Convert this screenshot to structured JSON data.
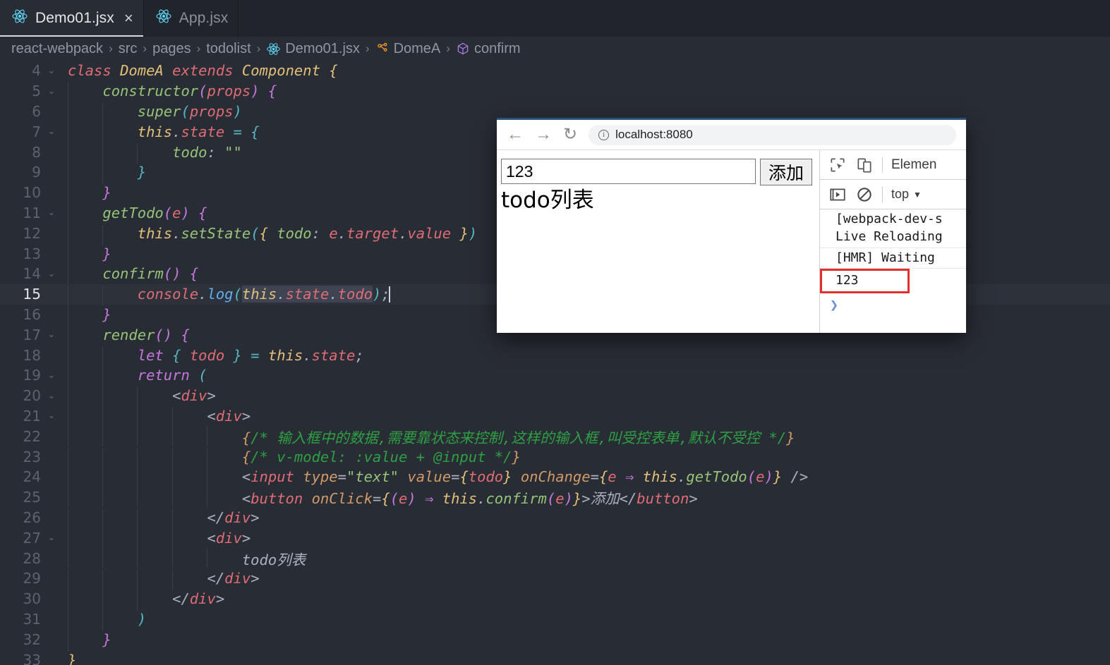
{
  "editor": {
    "tabs": [
      {
        "label": "Demo01.jsx",
        "icon": "react-icon",
        "active": true,
        "close": "×"
      },
      {
        "label": "App.jsx",
        "icon": "react-icon",
        "active": false,
        "close": ""
      }
    ],
    "breadcrumb": [
      {
        "label": "react-webpack",
        "icon": ""
      },
      {
        "label": "src",
        "icon": ""
      },
      {
        "label": "pages",
        "icon": ""
      },
      {
        "label": "todolist",
        "icon": ""
      },
      {
        "label": "Demo01.jsx",
        "icon": "react-icon"
      },
      {
        "label": "DomeA",
        "icon": "class-icon"
      },
      {
        "label": "confirm",
        "icon": "method-icon"
      }
    ],
    "separator": "›",
    "active_line": 15,
    "colors": {
      "background": "#282c34",
      "active_line": "#2c313a",
      "line_number": "#5c6370",
      "selection": "#3e4451"
    },
    "lines": [
      {
        "n": "4",
        "fold": "⌄",
        "indent": 0,
        "html": "<span class=\"kw2\">class</span> <span class=\"cls\">DomeA</span> <span class=\"kw2\">extends</span> <span class=\"cls\">Component</span> <span class=\"b1\">{</span>"
      },
      {
        "n": "5",
        "fold": "⌄",
        "indent": 1,
        "html": "    <span class=\"fng\">constructor</span><span class=\"b2\">(</span><span class=\"var\">props</span><span class=\"b2\">)</span> <span class=\"b2\">{</span>"
      },
      {
        "n": "6",
        "fold": "",
        "indent": 2,
        "html": "        <span class=\"fng\">super</span><span class=\"b3\">(</span><span class=\"var\">props</span><span class=\"b3\">)</span>"
      },
      {
        "n": "7",
        "fold": "⌄",
        "indent": 2,
        "html": "        <span class=\"this\">this</span><span class=\"txt\">.</span><span class=\"var\">state</span> <span class=\"op\">=</span> <span class=\"b3\">{</span>"
      },
      {
        "n": "8",
        "fold": "",
        "indent": 3,
        "html": "            <span class=\"fng\">todo</span><span class=\"txt\">:</span> <span class=\"str\">\"\"</span>"
      },
      {
        "n": "9",
        "fold": "",
        "indent": 2,
        "html": "        <span class=\"b3\">}</span>"
      },
      {
        "n": "10",
        "fold": "",
        "indent": 1,
        "html": "    <span class=\"b2\">}</span>"
      },
      {
        "n": "11",
        "fold": "⌄",
        "indent": 1,
        "html": "    <span class=\"fng\">getTodo</span><span class=\"b2\">(</span><span class=\"var\">e</span><span class=\"b2\">)</span> <span class=\"b2\">{</span>"
      },
      {
        "n": "12",
        "fold": "",
        "indent": 2,
        "html": "        <span class=\"this\">this</span><span class=\"txt\">.</span><span class=\"fng\">setState</span><span class=\"b3\">(</span><span class=\"b1\">{</span> <span class=\"fng\">todo</span><span class=\"txt\">:</span> <span class=\"var\">e</span><span class=\"txt\">.</span><span class=\"var\">target</span><span class=\"txt\">.</span><span class=\"var\">value</span> <span class=\"b1\">}</span><span class=\"b3\">)</span>"
      },
      {
        "n": "13",
        "fold": "",
        "indent": 1,
        "html": "    <span class=\"b2\">}</span>"
      },
      {
        "n": "14",
        "fold": "⌄",
        "indent": 1,
        "html": "    <span class=\"fng\">confirm</span><span class=\"b2\">()</span> <span class=\"b2\">{</span>"
      },
      {
        "n": "15",
        "fold": "",
        "indent": 2,
        "active": true,
        "html": "        <span class=\"var\">console</span><span class=\"txt\">.</span><span class=\"fn\">log</span><span class=\"b3\">(</span><span class=\"sel\"><span class=\"this\">this</span><span class=\"txt\">.</span><span class=\"var\">state</span><span class=\"txt\">.</span><span class=\"var\">todo</span></span><span class=\"b3\">)</span><span class=\"txt\">;</span>"
      },
      {
        "n": "16",
        "fold": "",
        "indent": 1,
        "html": "    <span class=\"b2\">}</span>"
      },
      {
        "n": "17",
        "fold": "⌄",
        "indent": 1,
        "html": "    <span class=\"fng\">render</span><span class=\"b2\">()</span> <span class=\"b2\">{</span>"
      },
      {
        "n": "18",
        "fold": "",
        "indent": 2,
        "html": "        <span class=\"k\">let</span> <span class=\"b3\">{</span> <span class=\"var\">todo</span> <span class=\"b3\">}</span> <span class=\"op\">=</span> <span class=\"this\">this</span><span class=\"txt\">.</span><span class=\"var\">state</span><span class=\"txt\">;</span>"
      },
      {
        "n": "19",
        "fold": "⌄",
        "indent": 2,
        "html": "        <span class=\"k\">return</span> <span class=\"b3\">(</span>"
      },
      {
        "n": "20",
        "fold": "⌄",
        "indent": 3,
        "html": "            <span class=\"txt\">&lt;</span><span class=\"tag\">div</span><span class=\"txt\">&gt;</span>"
      },
      {
        "n": "21",
        "fold": "⌄",
        "indent": 4,
        "html": "                <span class=\"txt\">&lt;</span><span class=\"tag\">div</span><span class=\"txt\">&gt;</span>"
      },
      {
        "n": "22",
        "fold": "",
        "indent": 5,
        "html": "                    <span class=\"att\">{</span><span class=\"cmt\">/* 输入框中的数据,需要靠状态来控制,这样的输入框,叫受控表单,默认不受控 */</span><span class=\"att\">}</span>"
      },
      {
        "n": "23",
        "fold": "",
        "indent": 5,
        "html": "                    <span class=\"att\">{</span><span class=\"cmt\">/* v-model: :value + @input */</span><span class=\"att\">}</span>"
      },
      {
        "n": "24",
        "fold": "",
        "indent": 5,
        "html": "                    <span class=\"txt\">&lt;</span><span class=\"tag\">input</span> <span class=\"att\">type</span><span class=\"txt\">=</span><span class=\"str\">\"text\"</span> <span class=\"att\">value</span><span class=\"txt\">=</span><span class=\"b1\">{</span><span class=\"var\">todo</span><span class=\"b1\">}</span> <span class=\"att\">onChange</span><span class=\"txt\">=</span><span class=\"b1\">{</span><span class=\"var\">e</span> <span class=\"k\">⇒</span> <span class=\"this\">this</span><span class=\"txt\">.</span><span class=\"fng\">getTodo</span><span class=\"b2\">(</span><span class=\"var\">e</span><span class=\"b2\">)</span><span class=\"b1\">}</span> <span class=\"txt\">/&gt;</span>"
      },
      {
        "n": "25",
        "fold": "",
        "indent": 5,
        "html": "                    <span class=\"txt\">&lt;</span><span class=\"tag\">button</span> <span class=\"att\">onClick</span><span class=\"txt\">=</span><span class=\"b1\">{</span><span class=\"b2\">(</span><span class=\"var\">e</span><span class=\"b2\">)</span> <span class=\"k\">⇒</span> <span class=\"this\">this</span><span class=\"txt\">.</span><span class=\"fng\">confirm</span><span class=\"b2\">(</span><span class=\"var\">e</span><span class=\"b2\">)</span><span class=\"b1\">}</span><span class=\"txt\">&gt;</span><span class=\"txt\">添加</span><span class=\"txt\">&lt;/</span><span class=\"tag\">button</span><span class=\"txt\">&gt;</span>"
      },
      {
        "n": "26",
        "fold": "",
        "indent": 4,
        "html": "                <span class=\"txt\">&lt;/</span><span class=\"tag\">div</span><span class=\"txt\">&gt;</span>"
      },
      {
        "n": "27",
        "fold": "⌄",
        "indent": 4,
        "html": "                <span class=\"txt\">&lt;</span><span class=\"tag\">div</span><span class=\"txt\">&gt;</span>"
      },
      {
        "n": "28",
        "fold": "",
        "indent": 5,
        "html": "                    <span class=\"txt\">todo列表</span>"
      },
      {
        "n": "29",
        "fold": "",
        "indent": 4,
        "html": "                <span class=\"txt\">&lt;/</span><span class=\"tag\">div</span><span class=\"txt\">&gt;</span>"
      },
      {
        "n": "30",
        "fold": "",
        "indent": 3,
        "html": "            <span class=\"txt\">&lt;/</span><span class=\"tag\">div</span><span class=\"txt\">&gt;</span>"
      },
      {
        "n": "31",
        "fold": "",
        "indent": 2,
        "html": "        <span class=\"b3\">)</span>"
      },
      {
        "n": "32",
        "fold": "",
        "indent": 1,
        "html": "    <span class=\"b2\">}</span>"
      },
      {
        "n": "33",
        "fold": "",
        "indent": 0,
        "html": "<span class=\"b1\">}</span>"
      }
    ]
  },
  "browser": {
    "toolbar": {
      "back": "←",
      "forward": "→",
      "reload": "↻",
      "url": "localhost:8080",
      "info_icon": "ⓘ"
    },
    "page": {
      "input_value": "123",
      "input_placeholder": "",
      "add_button": "添加",
      "list_title": "todo列表"
    },
    "devtools": {
      "inspect_icon": "inspect-element-icon",
      "device_icon": "device-toolbar-icon",
      "tab_label": "Elemen",
      "execute_icon": "execution-step-icon",
      "clear_icon": "clear-console-icon",
      "context": "top",
      "context_caret": "▼",
      "prompt": "❯",
      "console_messages": [
        {
          "text": "[webpack-dev-s\nLive Reloading",
          "highlight": false
        },
        {
          "text": "[HMR] Waiting ",
          "highlight": false
        },
        {
          "text": "123",
          "highlight": true
        }
      ],
      "highlight_color": "#e03030"
    }
  }
}
